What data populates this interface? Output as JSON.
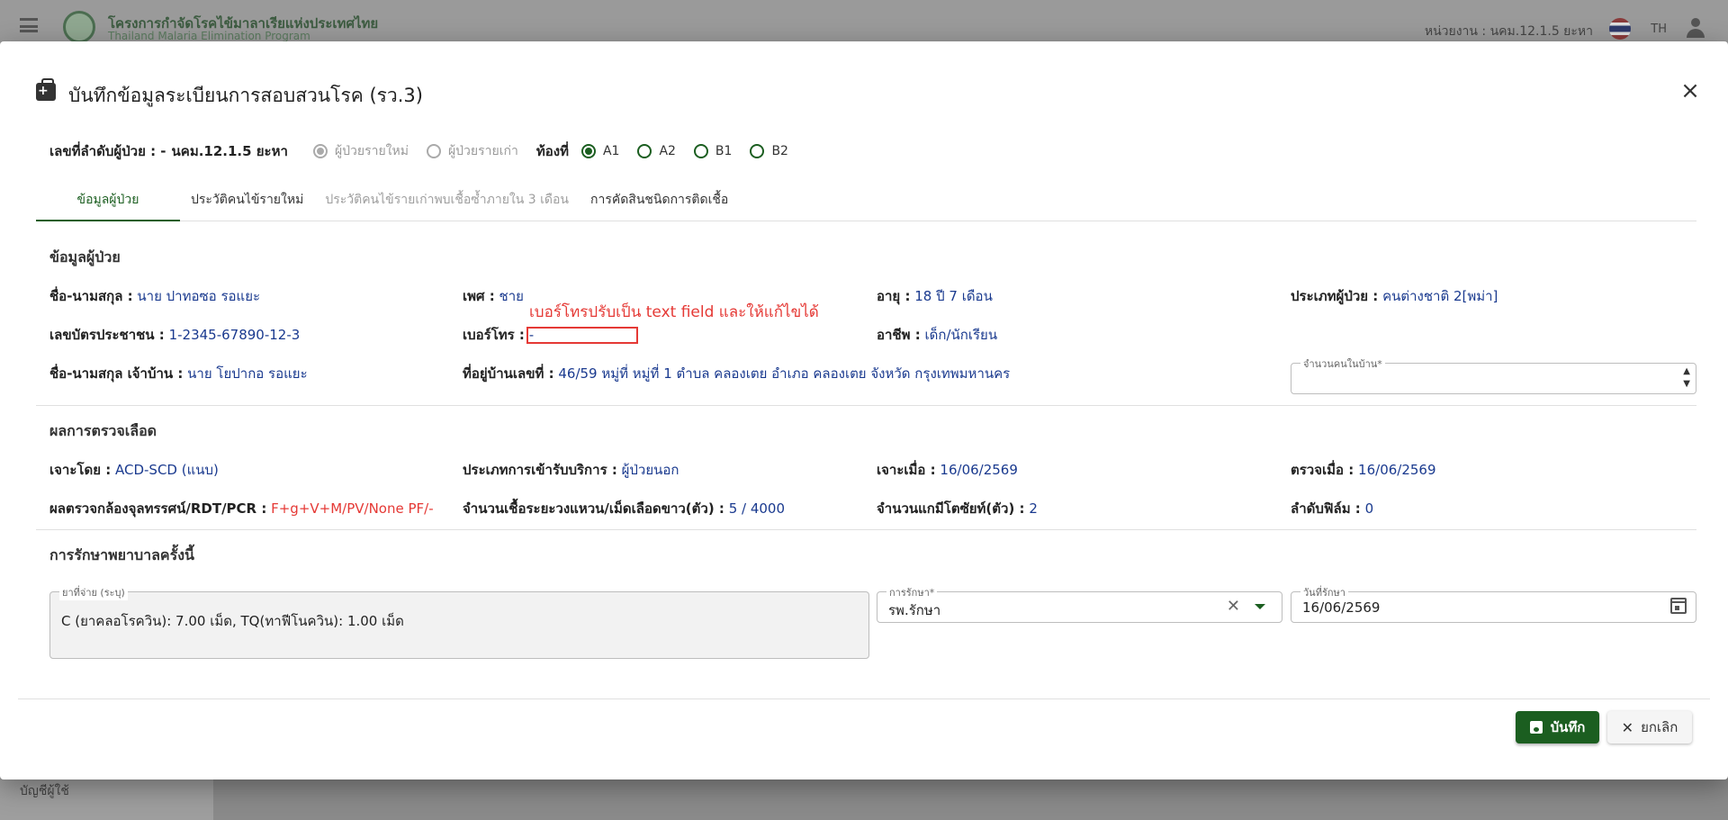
{
  "background": {
    "org_name": "โครงการกำจัดโรคไข้มาลาเรียแห่งประเทศไทย",
    "org_name_en": "Thailand Malaria Elimination Program",
    "unit_text": "หน่วยงาน : นคม.12.1.5 ยะหา",
    "lang": "TH",
    "side_item": "บัญชีผู้ใช้"
  },
  "dialog": {
    "title": "บันทึกข้อมูลระเบียนการสอบสวนโรค (รว.3)",
    "close_symbol": "×",
    "patient_no_label": "เลขที่ลำดับผู้ป่วย : -",
    "patient_no_value": "นคม.12.1.5 ยะหา",
    "patient_type_options": [
      {
        "label": "ผู้ป่วยรายใหม่",
        "selected": true
      },
      {
        "label": "ผู้ป่วยรายเก่า",
        "selected": false
      }
    ],
    "room_label": "ท้องที่",
    "room_options": [
      {
        "label": "A1",
        "selected": true
      },
      {
        "label": "A2",
        "selected": false
      },
      {
        "label": "B1",
        "selected": false
      },
      {
        "label": "B2",
        "selected": false
      }
    ],
    "tabs": [
      {
        "label": "ข้อมูลผู้ป่วย",
        "state": "active"
      },
      {
        "label": "ประวัติคนไข้รายใหม่",
        "state": "normal"
      },
      {
        "label": "ประวัติคนไข้รายเก่าพบเชื้อซ้ำภายใน 3 เดือน",
        "state": "disabled"
      },
      {
        "label": "การคัดสินชนิดการติดเชื้อ",
        "state": "normal"
      }
    ]
  },
  "patient": {
    "section": "ข้อมูลผู้ป่วย",
    "name_label": "ชื่อ-นามสกุล :",
    "name_value": "นาย ปาทอซอ รอแยะ",
    "sex_label": "เพศ :",
    "sex_value": "ชาย",
    "age_label": "อายุ :",
    "age_value": "18 ปี 7 เดือน",
    "ptype_label": "ประเภทผู้ป่วย :",
    "ptype_value": "คนต่างชาติ 2[พม่า]",
    "id_label": "เลขบัตรประชาชน :",
    "id_value": "1-2345-67890-12-3",
    "phone_label": "เบอร์โทร :",
    "phone_value": "-",
    "job_label": "อาชีพ :",
    "job_value": "เด็ก/นักเรียน",
    "owner_label": "ชื่อ-นามสกุล เจ้าบ้าน :",
    "owner_value": "นาย โยปากอ รอแยะ",
    "address_label": "ที่อยู่บ้านเลขที่ :",
    "address_value": "46/59  หมู่ที่ หมู่ที่ 1  ตำบล คลองเตย  อำเภอ คลองเตย  จังหวัด กรุงเทพมหานคร",
    "household_label": "จำนวนคนในบ้าน*",
    "household_value": "",
    "annotation": "เบอร์โทรปรับเป็น text field และให้แก้ไขได้"
  },
  "blood": {
    "section": "ผลการตรวจเลือด",
    "by_label": "เจาะโดย :",
    "by_value": "ACD-SCD (แนบ)",
    "service_label": "ประเภทการเข้ารับบริการ :",
    "service_value": "ผู้ป่วยนอก",
    "drawn_label": "เจาะเมื่อ :",
    "drawn_value": "16/06/2569",
    "checked_label": "ตรวจเมื่อ :",
    "checked_value": "16/06/2569",
    "result_label": "ผลตรวจกล้องจุลทรรศน์/RDT/PCR :",
    "result_value": "F+g+V+M/PV/None PF/-",
    "ring_label": "จำนวนเชื้อระยะวงแหวน/เม็ดเลือดขาว(ตัว) :",
    "ring_value": "5 / 4000",
    "gamete_label": "จำนวนแกมีโตซัยท์(ตัว) :",
    "gamete_value": "2",
    "film_label": "ลำดับฟิล์ม :",
    "film_value": "0"
  },
  "treatment": {
    "section": "การรักษาพยาบาลครั้งนี้",
    "drug_label": "ยาที่จ่าย (ระบุ)",
    "drug_value": "C (ยาคลอโรควิน): 7.00 เม็ด, TQ(ทาฟีโนควิน): 1.00 เม็ด",
    "method_label": "การรักษา*",
    "method_value": "รพ.รักษา",
    "date_label": "วันที่รักษา",
    "date_value": "16/06/2569"
  },
  "footer": {
    "save_label": "บันทึก",
    "cancel_label": "ยกเลิก"
  },
  "colors": {
    "primary": "#1b5e20",
    "value_text": "#1a3a8f",
    "alert": "#e53935"
  }
}
